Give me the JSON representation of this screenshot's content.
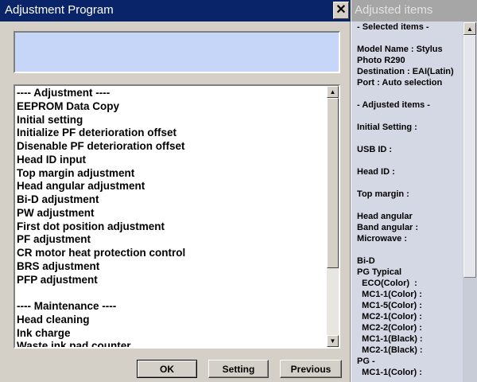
{
  "window": {
    "title": "Adjustment Program",
    "close_glyph": "✕",
    "message": ""
  },
  "list_items": [
    "---- Adjustment ----",
    "EEPROM Data Copy",
    "Initial setting",
    "Initialize PF deterioration offset",
    "Disenable PF deterioration offset",
    "Head ID input",
    "Top margin adjustment",
    "Head angular adjustment",
    "Bi-D adjustment",
    "PW adjustment",
    "First dot position adjustment",
    "PF adjustment",
    "CR motor heat protection control",
    "BRS adjustment",
    "PFP adjustment",
    "",
    "---- Maintenance ----",
    "Head cleaning",
    "Ink charge",
    "Waste ink pad counter"
  ],
  "buttons": {
    "ok": "OK",
    "setting": "Setting",
    "previous": "Previous"
  },
  "panel": {
    "title": "Adjusted items",
    "lines": [
      " - Selected items -",
      "",
      " Model Name : Stylus",
      " Photo R290",
      " Destination : EAI(Latin)",
      " Port : Auto selection",
      "",
      " - Adjusted items -",
      "",
      " Initial Setting :",
      "",
      " USB ID :",
      "",
      " Head ID :",
      "",
      " Top margin :",
      "",
      " Head angular",
      " Band angular :",
      " Microwave :",
      "",
      " Bi-D",
      " PG Typical",
      "   ECO(Color)  :",
      "   MC1-1(Color) :",
      "   MC1-5(Color) :",
      "   MC2-1(Color) :",
      "   MC2-2(Color) :",
      "   MC1-1(Black) :",
      "   MC2-1(Black) :",
      " PG -",
      "   MC1-1(Color) :"
    ]
  },
  "icons": {
    "scroll_up": "▲",
    "scroll_down": "▼"
  },
  "colors": {
    "titlebar": "#0a246a",
    "message_box": "#c6d6f9",
    "panel_background": "#d4d8e4"
  }
}
